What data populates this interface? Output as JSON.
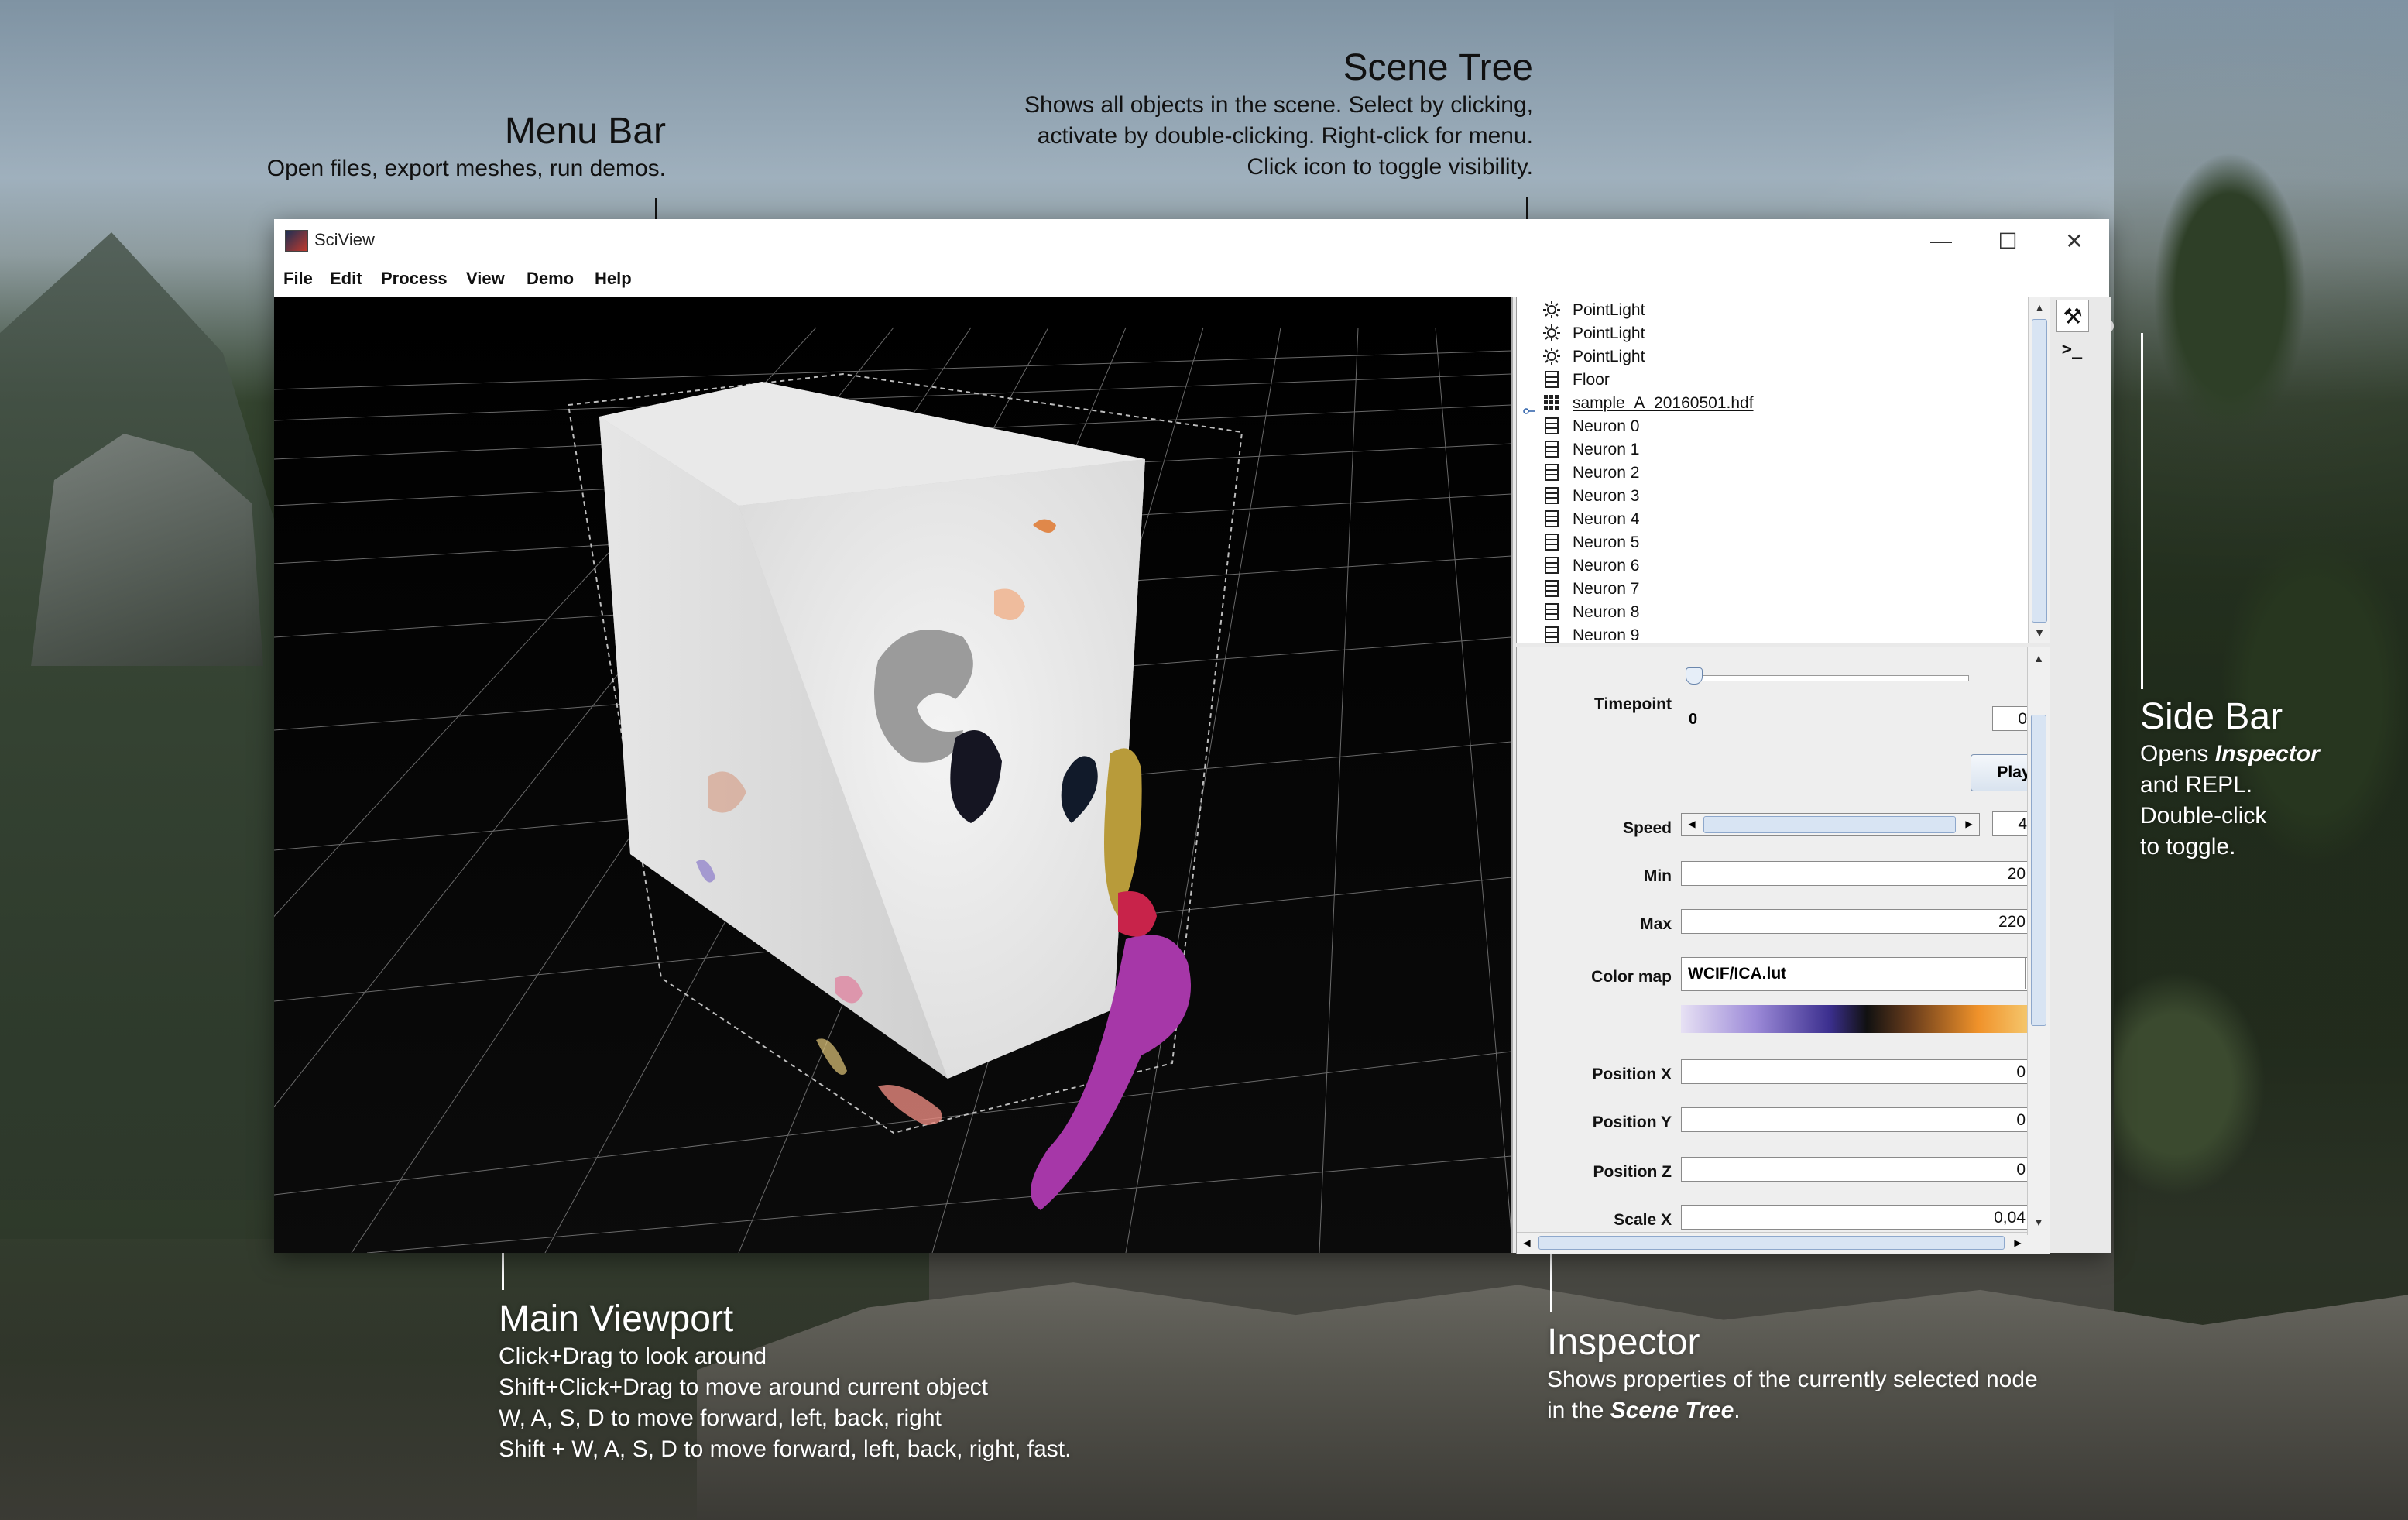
{
  "annotations": {
    "menu_bar": {
      "title": "Menu Bar",
      "desc": "Open files, export meshes, run demos."
    },
    "scene_tree": {
      "title": "Scene Tree",
      "lines": [
        "Shows all objects in the scene. Select by clicking,",
        "activate by double-clicking. Right-click for menu.",
        "Click icon to toggle visibility."
      ]
    },
    "side_bar": {
      "title": "Side Bar",
      "line1_pre": "Opens ",
      "line1_em": "Inspector",
      "line2": "and REPL.",
      "line3": "Double-click",
      "line4": "to toggle."
    },
    "main_viewport": {
      "title": "Main Viewport",
      "lines": [
        "Click+Drag to look around",
        "Shift+Click+Drag to move around current object",
        "W, A, S, D to move forward, left, back, right",
        "Shift + W, A, S, D to move forward, left, back, right, fast."
      ]
    },
    "inspector": {
      "title": "Inspector",
      "line1": "Shows properties of the currently selected node",
      "line2_pre": "in the ",
      "line2_em": "Scene Tree",
      "line2_post": "."
    }
  },
  "window": {
    "title": "SciView",
    "controls": {
      "minimize": "—",
      "maximize": "☐",
      "close": "✕"
    },
    "menu": [
      "File",
      "Edit",
      "Process",
      "View",
      "Demo",
      "Help"
    ]
  },
  "scene_tree": {
    "items": [
      {
        "label": "PointLight",
        "icon": "light-icon"
      },
      {
        "label": "PointLight",
        "icon": "light-icon"
      },
      {
        "label": "PointLight",
        "icon": "light-icon"
      },
      {
        "label": "Floor",
        "icon": "mesh-icon"
      },
      {
        "label": "sample_A_20160501.hdf",
        "icon": "volume-icon",
        "selected": true
      },
      {
        "label": "Neuron 0",
        "icon": "mesh-icon"
      },
      {
        "label": "Neuron 1",
        "icon": "mesh-icon"
      },
      {
        "label": "Neuron 2",
        "icon": "mesh-icon"
      },
      {
        "label": "Neuron 3",
        "icon": "mesh-icon"
      },
      {
        "label": "Neuron 4",
        "icon": "mesh-icon"
      },
      {
        "label": "Neuron 5",
        "icon": "mesh-icon"
      },
      {
        "label": "Neuron 6",
        "icon": "mesh-icon"
      },
      {
        "label": "Neuron 7",
        "icon": "mesh-icon"
      },
      {
        "label": "Neuron 8",
        "icon": "mesh-icon"
      },
      {
        "label": "Neuron 9",
        "icon": "mesh-icon"
      }
    ]
  },
  "inspector": {
    "timepoint": {
      "label": "Timepoint",
      "slider_min_label": "0",
      "value": "0",
      "position": 0
    },
    "play_label": "Play",
    "speed": {
      "label": "Speed",
      "value": "4"
    },
    "min": {
      "label": "Min",
      "value": "20"
    },
    "max": {
      "label": "Max",
      "value": "220"
    },
    "colormap": {
      "label": "Color map",
      "value": "WCIF/ICA.lut"
    },
    "position_x": {
      "label": "Position X",
      "value": "0"
    },
    "position_y": {
      "label": "Position Y",
      "value": "0"
    },
    "position_z": {
      "label": "Position Z",
      "value": "0"
    },
    "scale_x": {
      "label": "Scale X",
      "value": "0,04"
    }
  },
  "colors": {
    "accent": "#2a5ea8",
    "viewport_bg": "#050505",
    "panel_bg": "#eeeeee"
  }
}
